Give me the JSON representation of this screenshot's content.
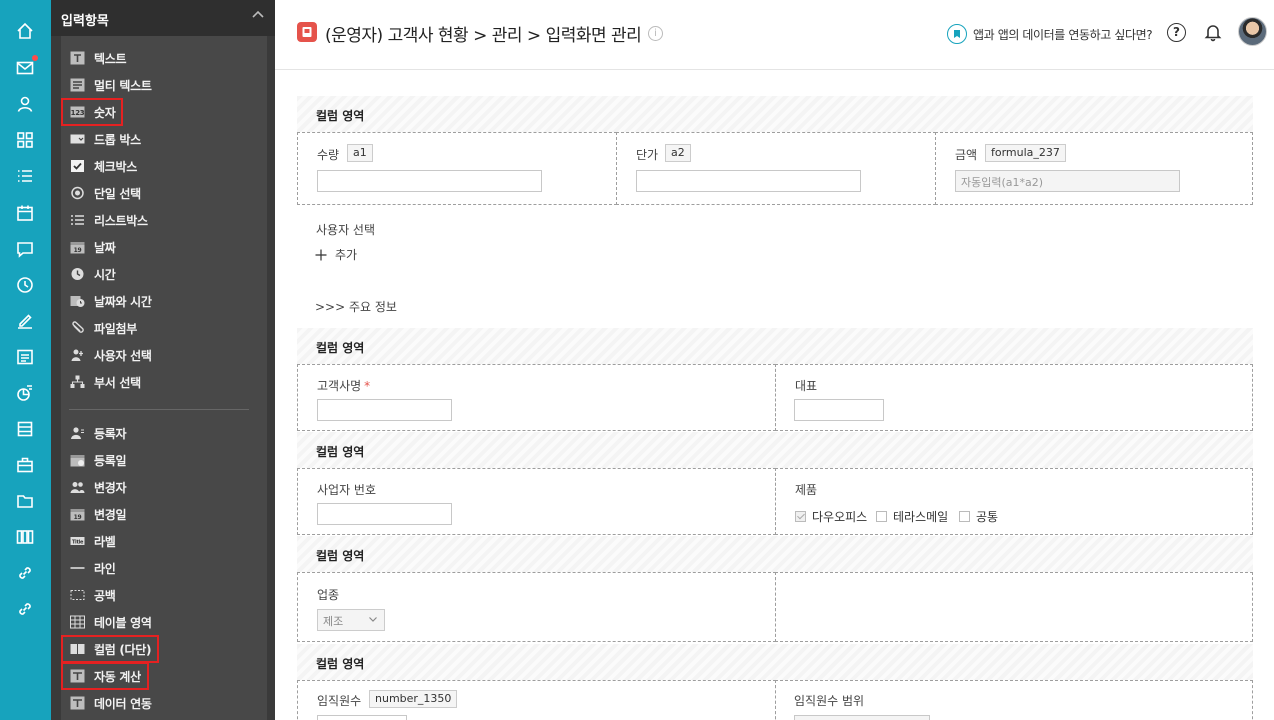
{
  "palette": {
    "title": "입력항목",
    "items": [
      {
        "label": "텍스트",
        "icon": "text-icon"
      },
      {
        "label": "멀티 텍스트",
        "icon": "multi-text-icon"
      },
      {
        "label": "숫자",
        "icon": "number-icon"
      },
      {
        "label": "드롭 박스",
        "icon": "dropbox-icon"
      },
      {
        "label": "체크박스",
        "icon": "checkbox-icon"
      },
      {
        "label": "단일 선택",
        "icon": "radio-icon"
      },
      {
        "label": "리스트박스",
        "icon": "list-icon"
      },
      {
        "label": "날짜",
        "icon": "calendar-icon"
      },
      {
        "label": "시간",
        "icon": "clock-icon"
      },
      {
        "label": "날짜와 시간",
        "icon": "datetime-icon"
      },
      {
        "label": "파일첨부",
        "icon": "paperclip-icon"
      },
      {
        "label": "사용자 선택",
        "icon": "user-select-icon"
      },
      {
        "label": "부서 선택",
        "icon": "org-icon"
      },
      {
        "label": "등록자",
        "icon": "user-icon"
      },
      {
        "label": "등록일",
        "icon": "calendar-icon"
      },
      {
        "label": "변경자",
        "icon": "users-icon"
      },
      {
        "label": "변경일",
        "icon": "calendar-icon"
      },
      {
        "label": "라벨",
        "icon": "label-icon"
      },
      {
        "label": "라인",
        "icon": "line-icon"
      },
      {
        "label": "공백",
        "icon": "blank-icon"
      },
      {
        "label": "테이블 영역",
        "icon": "table-icon"
      },
      {
        "label": "컬럼 (다단)",
        "icon": "columns-icon"
      },
      {
        "label": "자동 계산",
        "icon": "calc-icon"
      },
      {
        "label": "데이터 연동",
        "icon": "link-data-icon"
      }
    ]
  },
  "header": {
    "title": "(운영자) 고객사 현황 > 관리 > 입력화면 관리",
    "info": "i",
    "link_text": "앱과 앱의 데이터를 연동하고 싶다면?",
    "help": "?"
  },
  "form": {
    "section_label": "컬럼 영역",
    "quantity_label": "수량",
    "quantity_tag": "a1",
    "price_label": "단가",
    "price_tag": "a2",
    "amount_label": "금액",
    "amount_tag": "formula_237",
    "amount_value": "자동입력(a1*a2)",
    "user_select_label": "사용자 선택",
    "add_label": "추가",
    "main_info": ">>> 주요 정보",
    "company_label": "고객사명",
    "required_mark": "*",
    "ceo_label": "대표",
    "bizno_label": "사업자 번호",
    "product_label": "제품",
    "products": [
      "다우오피스",
      "테라스메일",
      "공통"
    ],
    "industry_label": "업종",
    "industry_value": "제조",
    "employees_label": "임직원수",
    "employees_tag": "number_1350",
    "employees_range_label": "임직원수 범위"
  }
}
